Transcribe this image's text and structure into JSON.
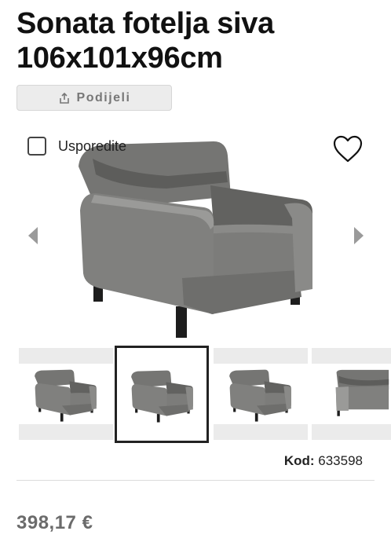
{
  "product": {
    "title": "Sonata fotelja siva 106x101x96cm",
    "code_label": "Kod:",
    "code_value": "633598",
    "price": "398,17 €"
  },
  "actions": {
    "share_label": "Podijeli",
    "compare_label": "Usporedite"
  },
  "gallery": {
    "thumbnails": [
      {
        "icon": "armchair-front-view"
      },
      {
        "icon": "armchair-front-view",
        "active": true
      },
      {
        "icon": "armchair-front-view"
      },
      {
        "icon": "armchair-side-view"
      }
    ]
  },
  "colors": {
    "text": "#111111",
    "price": "#6b6b6b",
    "chair": "#6f6f6d"
  }
}
